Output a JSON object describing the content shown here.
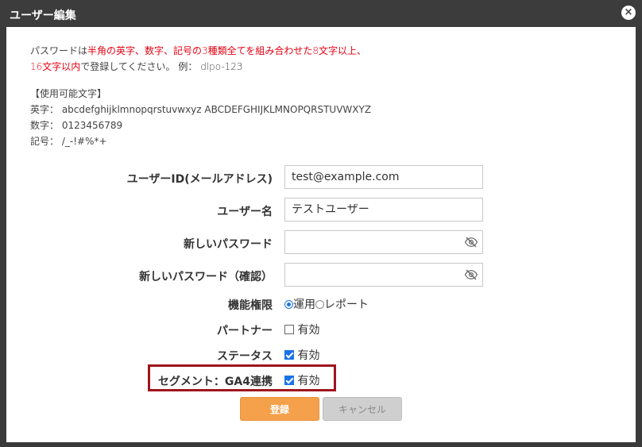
{
  "dialog": {
    "title": "ユーザー編集",
    "close_glyph": "×"
  },
  "notice": {
    "line1_a": "パスワードは",
    "line1_red": "半角の英字、数字、記号の3種類全てを組み合わせた8文字以上、",
    "line2_red": "16文字以内",
    "line2_b": "で登録してください。 例： dlpo-123"
  },
  "chars": {
    "heading": "【使用可能文字】",
    "alpha": "英字： abcdefghijklmnopqrstuvwxyz ABCDEFGHIJKLMNOPQRSTUVWXYZ",
    "digits": "数字： 0123456789",
    "symbols": "記号： /_-!#%*+"
  },
  "form": {
    "user_id_label": "ユーザーID(メールアドレス)",
    "user_id_value": "test@example.com",
    "user_name_label": "ユーザー名",
    "user_name_value": "テストユーザー",
    "new_password_label": "新しいパスワード",
    "new_password_value": "",
    "confirm_password_label": "新しいパスワード（確認）",
    "confirm_password_value": "",
    "role_label": "機能権限",
    "role_options": [
      "運用",
      "レポート"
    ],
    "role_selected": "運用",
    "partner_label": "パートナー",
    "partner_checkbox_label": "有効",
    "partner_checked": false,
    "status_label": "ステータス",
    "status_checkbox_label": "有効",
    "status_checked": true,
    "segment_label": "セグメント：GA4連携",
    "segment_checkbox_label": "有効",
    "segment_checked": true
  },
  "buttons": {
    "register": "登録",
    "cancel": "キャンセル"
  },
  "colors": {
    "accent": "#f5a04a",
    "warning_text": "#e60012",
    "highlight_border": "#a0141e",
    "checkbox": "#1a73e8"
  },
  "icons": {
    "password_toggle": "eye-slash-icon"
  }
}
